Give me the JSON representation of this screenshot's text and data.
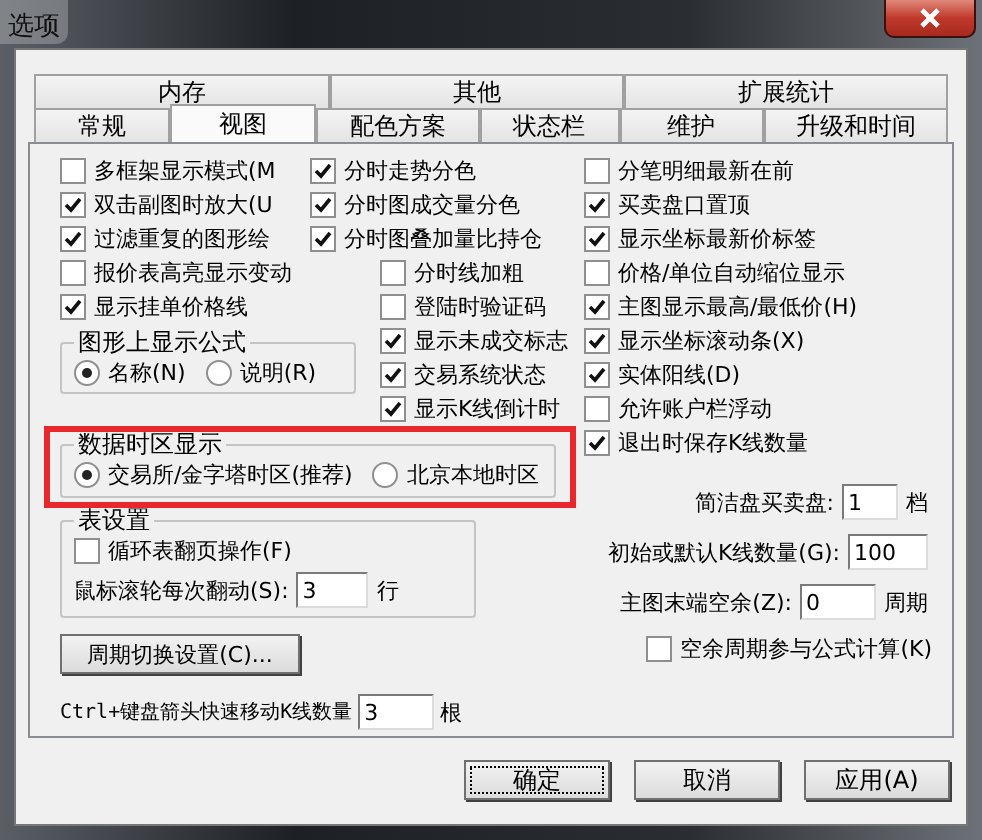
{
  "window": {
    "title": "选项"
  },
  "tab_rows": [
    [
      {
        "label": "内存",
        "selected": false
      },
      {
        "label": "其他",
        "selected": false
      },
      {
        "label": "扩展统计",
        "selected": false
      }
    ],
    [
      {
        "label": "常规",
        "selected": false
      },
      {
        "label": "视图",
        "selected": true
      },
      {
        "label": "配色方案",
        "selected": false
      },
      {
        "label": "状态栏",
        "selected": false
      },
      {
        "label": "维护",
        "selected": false
      },
      {
        "label": "升级和时间",
        "selected": false
      }
    ]
  ],
  "column_1": [
    {
      "label": "多框架显示模式(M",
      "checked": false
    },
    {
      "label": "双击副图时放大(U",
      "checked": true
    },
    {
      "label": "过滤重复的图形绘",
      "checked": true
    },
    {
      "label": "报价表高亮显示变动",
      "checked": false
    },
    {
      "label": "显示挂单价格线",
      "checked": true
    }
  ],
  "column_2": [
    {
      "label": "分时走势分色",
      "checked": true
    },
    {
      "label": "分时图成交量分色",
      "checked": true
    },
    {
      "label": "分时图叠加量比持仓",
      "checked": true
    }
  ],
  "column_2b": [
    {
      "label": "分时线加粗",
      "checked": false
    },
    {
      "label": "登陆时验证码",
      "checked": false
    },
    {
      "label": "显示未成交标志",
      "checked": true
    },
    {
      "label": "交易系统状态",
      "checked": true
    },
    {
      "label": "显示K线倒计时",
      "checked": true
    }
  ],
  "column_3": [
    {
      "label": "分笔明细最新在前",
      "checked": false
    },
    {
      "label": "买卖盘口置顶",
      "checked": true
    },
    {
      "label": "显示坐标最新价标签",
      "checked": true
    },
    {
      "label": "价格/单位自动缩位显示",
      "checked": false
    },
    {
      "label": "主图显示最高/最低价(H)",
      "checked": true
    },
    {
      "label": "显示坐标滚动条(X)",
      "checked": true
    },
    {
      "label": "实体阳线(D)",
      "checked": true
    },
    {
      "label": "允许账户栏浮动",
      "checked": false
    },
    {
      "label": "退出时保存K线数量",
      "checked": true
    }
  ],
  "formula_display": {
    "title": "图形上显示公式",
    "options": [
      {
        "label": "名称(N)",
        "selected": true
      },
      {
        "label": "说明(R)",
        "selected": false
      }
    ]
  },
  "timezone": {
    "title": "数据时区显示",
    "highlighted": true,
    "options": [
      {
        "label": "交易所/金字塔时区(推荐)",
        "selected": true
      },
      {
        "label": "北京本地时区",
        "selected": false
      }
    ]
  },
  "table_settings": {
    "title": "表设置",
    "checkbox": {
      "label": "循环表翻页操作(F)",
      "checked": false
    },
    "field": {
      "label": "鼠标滚轮每次翻动(S):",
      "value": "3",
      "unit": "行"
    }
  },
  "cycle_button": "周期切换设置(C)...",
  "kline_step": {
    "label": "Ctrl+键盘箭头快速移动K线数量",
    "value": "3",
    "unit": "根"
  },
  "right_fields": [
    {
      "label": "简洁盘买卖盘:",
      "value": "1",
      "unit": "档"
    },
    {
      "label": "初始或默认K线数量(G):",
      "value": "100"
    },
    {
      "label": "主图末端空余(Z):",
      "value": "0",
      "unit": "周期"
    }
  ],
  "right_checkbox": {
    "label": "空余周期参与公式计算(K)",
    "checked": false
  },
  "buttons": [
    {
      "label": "确定",
      "focused": true
    },
    {
      "label": "取消",
      "focused": false
    },
    {
      "label": "应用(A)",
      "focused": false
    }
  ]
}
